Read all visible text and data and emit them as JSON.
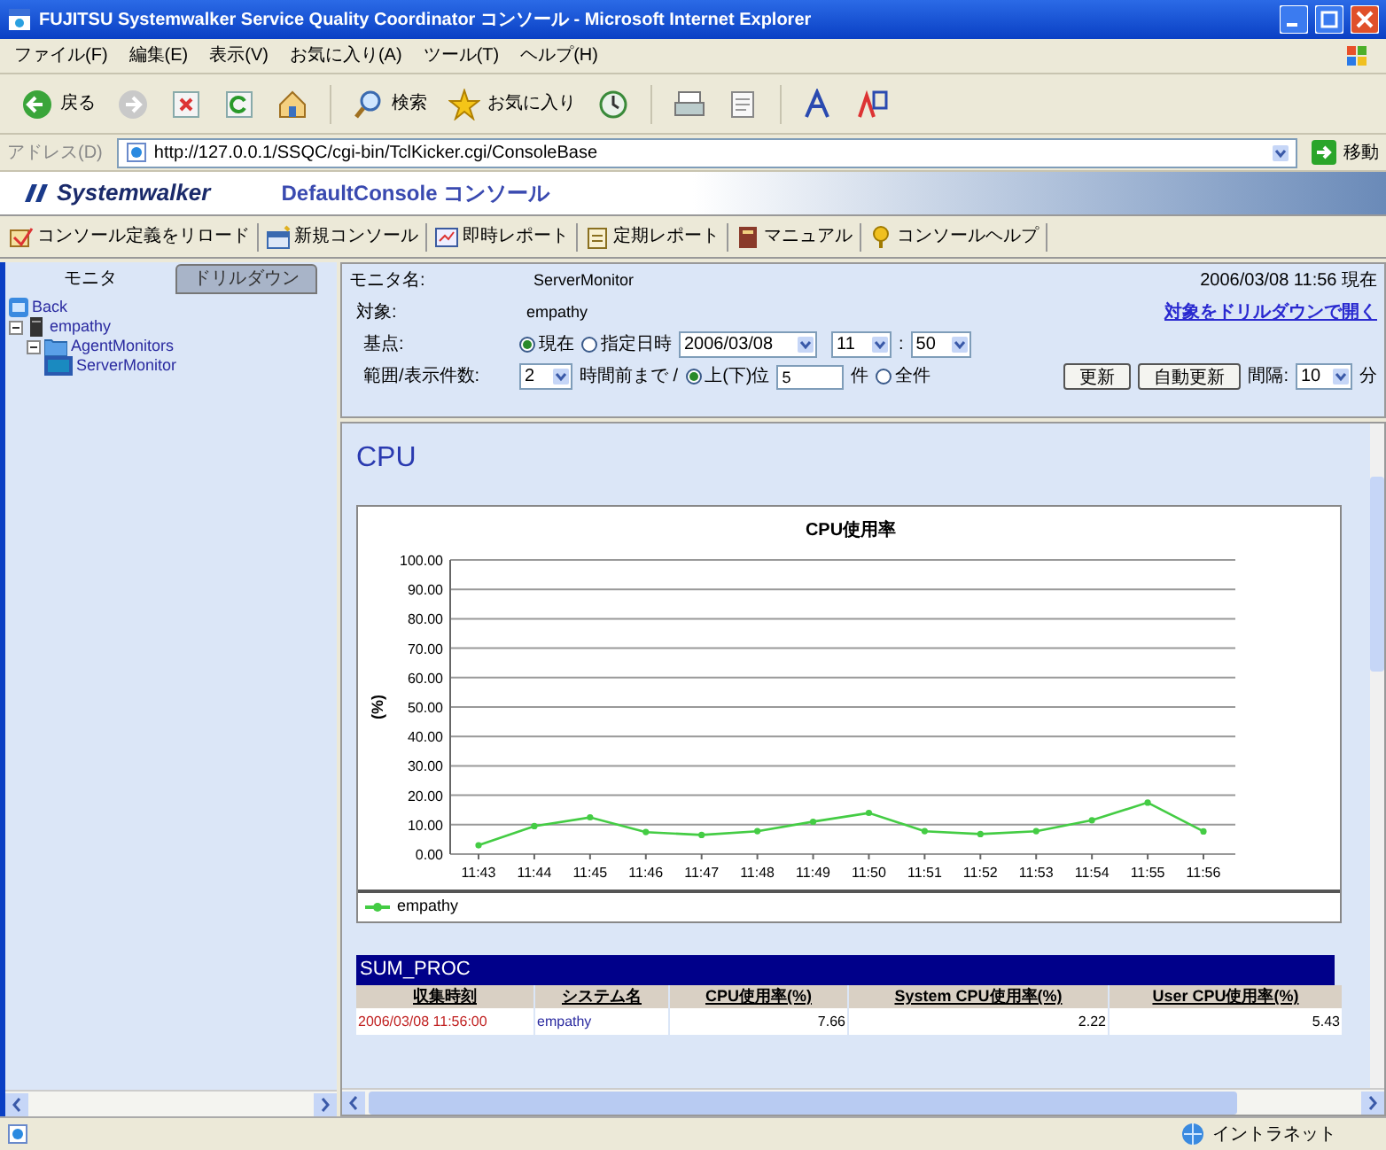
{
  "window": {
    "title": "FUJITSU Systemwalker Service Quality Coordinator コンソール - Microsoft Internet Explorer"
  },
  "menu": [
    "ファイル(F)",
    "編集(E)",
    "表示(V)",
    "お気に入り(A)",
    "ツール(T)",
    "ヘルプ(H)"
  ],
  "toolbar": [
    {
      "kind": "back",
      "label": "戻る"
    },
    {
      "kind": "forward"
    },
    {
      "kind": "stop"
    },
    {
      "kind": "refresh"
    },
    {
      "kind": "home"
    },
    {
      "kind": "search",
      "label": "検索"
    },
    {
      "kind": "favorites",
      "label": "お気に入り"
    },
    {
      "kind": "history"
    },
    {
      "kind": "print"
    },
    {
      "kind": "edit"
    },
    {
      "kind": "font"
    },
    {
      "kind": "translate"
    }
  ],
  "address": {
    "label": "アドレス(D)",
    "value": "http://127.0.0.1/SSQC/cgi-bin/TclKicker.cgi/ConsoleBase",
    "go": "移動"
  },
  "banner": {
    "logo": "Systemwalker",
    "title": "DefaultConsole コンソール"
  },
  "console_toolbar": [
    {
      "kind": "reload",
      "label": "コンソール定義をリロード"
    },
    {
      "kind": "new",
      "label": "新規コンソール"
    },
    {
      "kind": "report",
      "label": "即時レポート"
    },
    {
      "kind": "schedule",
      "label": "定期レポート"
    },
    {
      "kind": "manual",
      "label": "マニュアル"
    },
    {
      "kind": "help",
      "label": "コンソールヘルプ"
    }
  ],
  "sidebar": {
    "tabs": [
      {
        "label": "モニタ",
        "selected": true
      },
      {
        "label": "ドリルダウン",
        "selected": false
      }
    ],
    "tree": [
      {
        "kind": "back",
        "label": "Back"
      },
      {
        "kind": "host",
        "label": "empathy",
        "expanded": true,
        "children": [
          {
            "kind": "folder",
            "label": "AgentMonitors",
            "expanded": true,
            "children": [
              {
                "kind": "monitor",
                "label": "ServerMonitor"
              }
            ]
          }
        ]
      }
    ]
  },
  "form": {
    "monitor_label": "モニタ名:",
    "monitor_value": "ServerMonitor",
    "target_label": "対象:",
    "target_value": "empathy",
    "timestamp": "2006/03/08 11:56 現在",
    "drilldown_link": "対象をドリルダウンで開く",
    "base_label": "基点:",
    "base_options": [
      {
        "label": "現在",
        "selected": true
      },
      {
        "label": "指定日時",
        "selected": false
      }
    ],
    "date": "2006/03/08",
    "hour": "11",
    "time_separator": ":",
    "minute": "50",
    "range_label": "範囲/表示件数:",
    "hours": "2",
    "hours_suffix": "時間前まで /",
    "rank_option": {
      "label": "上(下)位",
      "selected": true
    },
    "count": "5",
    "count_unit": "件",
    "all_option": {
      "label": "全件",
      "selected": false
    },
    "buttons": [
      "更新",
      "自動更新"
    ],
    "interval_label": "間隔:",
    "interval": "10",
    "interval_unit": "分"
  },
  "content": {
    "heading": "CPU",
    "chart_data": {
      "type": "line",
      "title": "CPU使用率",
      "ylabel": "(%)",
      "categories": [
        "11:43",
        "11:44",
        "11:45",
        "11:46",
        "11:47",
        "11:48",
        "11:49",
        "11:50",
        "11:51",
        "11:52",
        "11:53",
        "11:54",
        "11:55",
        "11:56"
      ],
      "series": [
        {
          "name": "empathy",
          "color": "#44cc44",
          "marker": "circle",
          "values": [
            3,
            9.5,
            12.5,
            7.5,
            6.5,
            7.8,
            11,
            14,
            7.8,
            6.8,
            7.8,
            11.5,
            17.5,
            7.7
          ]
        }
      ],
      "grid": true,
      "ylim": [
        0,
        100
      ],
      "yticks": [
        {
          "value": 0,
          "label": "0.00"
        },
        {
          "value": 10,
          "label": "10.00"
        },
        {
          "value": 20,
          "label": "20.00"
        },
        {
          "value": 30,
          "label": "30.00"
        },
        {
          "value": 40,
          "label": "40.00"
        },
        {
          "value": 50,
          "label": "50.00"
        },
        {
          "value": 60,
          "label": "60.00"
        },
        {
          "value": 70,
          "label": "70.00"
        },
        {
          "value": 80,
          "label": "80.00"
        },
        {
          "value": 90,
          "label": "90.00"
        },
        {
          "value": 100,
          "label": "100.00"
        }
      ]
    },
    "table": {
      "title": "SUM_PROC",
      "columns": [
        "収集時刻",
        "システム名",
        "CPU使用率(%)",
        "System CPU使用率(%)",
        "User CPU使用率(%)"
      ],
      "rows": [
        [
          "2006/03/08 11:56:00",
          "empathy",
          "7.66",
          "2.22",
          "5.43"
        ]
      ]
    }
  },
  "status_bar": {
    "zone": "イントラネット"
  }
}
